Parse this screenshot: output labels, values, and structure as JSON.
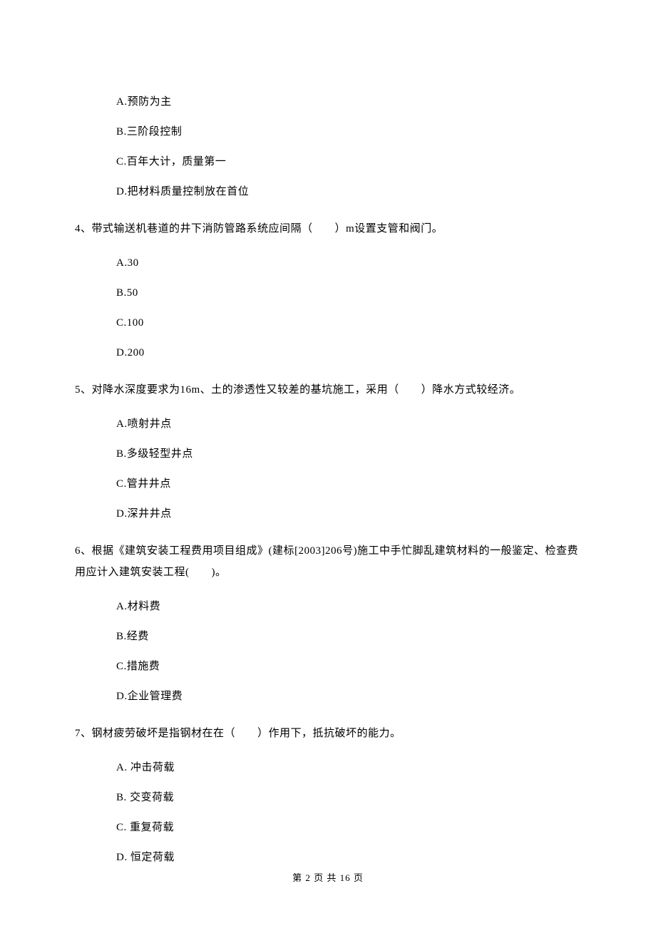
{
  "q3": {
    "options": {
      "a": "A.预防为主",
      "b": "B.三阶段控制",
      "c": "C.百年大计，质量第一",
      "d": "D.把材料质量控制放在首位"
    }
  },
  "q4": {
    "stem": "4、带式输送机巷道的井下消防管路系统应间隔（　　）m设置支管和阀门。",
    "options": {
      "a": "A.30",
      "b": "B.50",
      "c": "C.100",
      "d": "D.200"
    }
  },
  "q5": {
    "stem": "5、对降水深度要求为16m、土的渗透性又较差的基坑施工，采用（　　）降水方式较经济。",
    "options": {
      "a": "A.喷射井点",
      "b": "B.多级轻型井点",
      "c": "C.管井井点",
      "d": "D.深井井点"
    }
  },
  "q6": {
    "stem": "6、根据《建筑安装工程费用项目组成》(建标[2003]206号)施工中手忙脚乱建筑材料的一般鉴定、检查费用应计入建筑安装工程(　　)。",
    "options": {
      "a": "A.材料费",
      "b": "B.经费",
      "c": "C.措施费",
      "d": "D.企业管理费"
    }
  },
  "q7": {
    "stem": "7、钢材疲劳破坏是指钢材在在（　　）作用下，抵抗破坏的能力。",
    "options": {
      "a": "A. 冲击荷载",
      "b": "B. 交变荷载",
      "c": "C. 重复荷载",
      "d": "D. 恒定荷载"
    }
  },
  "footer": "第 2 页 共 16 页"
}
